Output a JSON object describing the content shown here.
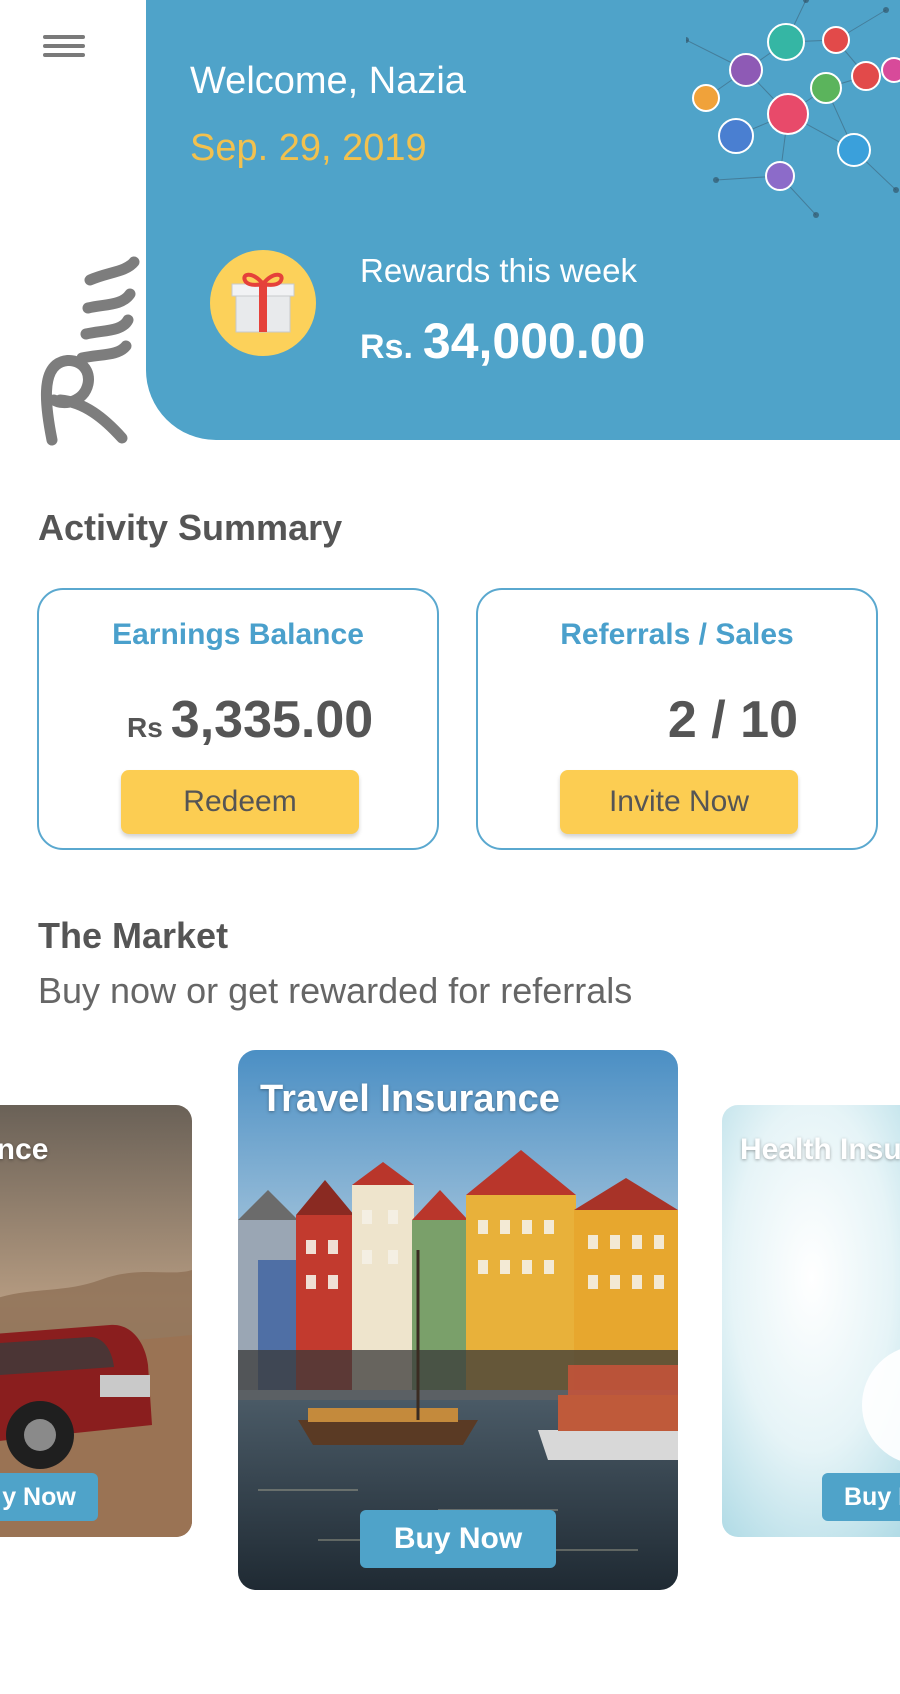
{
  "header": {
    "menu_icon": "hamburger-menu-icon",
    "logo_icon": "brand-signature-logo",
    "greeting": "Welcome, Nazia",
    "date": "Sep. 29, 2019",
    "rewards_label": "Rewards this week",
    "rewards_currency": "Rs.",
    "rewards_amount": "34,000.00",
    "gift_icon": "gift-icon",
    "network_icon": "people-network-illustration"
  },
  "activity": {
    "title": "Activity Summary",
    "earnings": {
      "label": "Earnings Balance",
      "currency": "Rs",
      "value": "3,335.00",
      "button": "Redeem"
    },
    "referrals": {
      "label": "Referrals / Sales",
      "value": "2 / 10",
      "button": "Invite Now"
    }
  },
  "market": {
    "title": "The Market",
    "subtitle": "Buy now or get rewarded for referrals",
    "products": [
      {
        "title": "ance",
        "button": "y Now"
      },
      {
        "title": "Travel Insurance",
        "button": "Buy Now"
      },
      {
        "title": "Health Insu",
        "button": "Buy I"
      }
    ]
  },
  "colors": {
    "primary": "#4fa3c9",
    "accent": "#fccd52",
    "date": "#f2c14e"
  }
}
